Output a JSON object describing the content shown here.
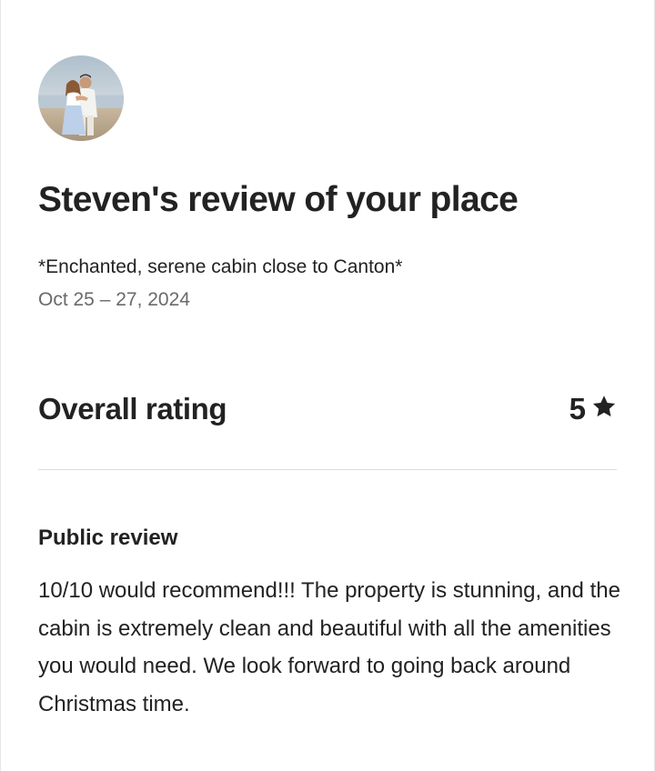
{
  "header": {
    "title": "Steven's review of your place"
  },
  "listing": {
    "name": "*Enchanted, serene cabin close to Canton*",
    "dates": "Oct 25 – 27, 2024"
  },
  "rating": {
    "label": "Overall rating",
    "value": "5",
    "icon": "star-icon"
  },
  "review": {
    "heading": "Public review",
    "text": "10/10 would recommend!!! The property is stunning, and the cabin is extremely clean and beautiful with all the amenities you would need. We look forward to going back around Christmas time."
  },
  "colors": {
    "primary_text": "#222222",
    "secondary_text": "#6a6a6a",
    "divider": "#dddddd",
    "background": "#ffffff"
  }
}
